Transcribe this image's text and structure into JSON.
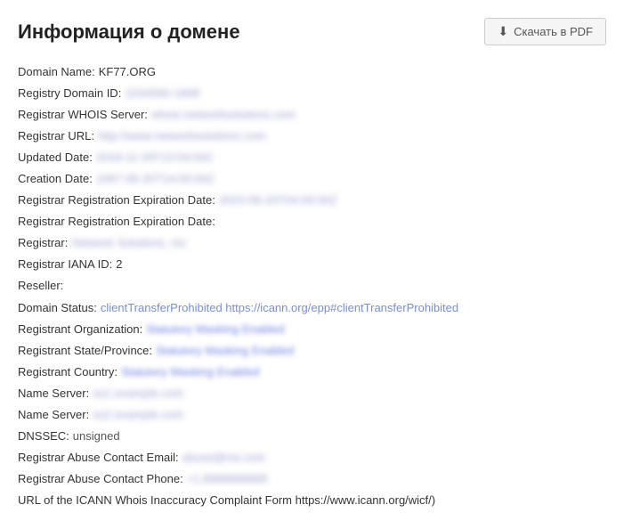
{
  "header": {
    "title": "Информация о домене",
    "pdf_button_label": "Скачать в PDF"
  },
  "whois": {
    "rows": [
      {
        "label": "Domain Name:",
        "value": "KF77.ORG",
        "type": "plain"
      },
      {
        "label": "Registry Domain ID:",
        "value": "1034560-1808",
        "type": "blur"
      },
      {
        "label": "Registrar WHOIS Server:",
        "value": "whois.networksolutions.com",
        "type": "blur"
      },
      {
        "label": "Registrar URL:",
        "value": "http://www.networksolutions.com",
        "type": "blur"
      },
      {
        "label": "Updated Date:",
        "value": "2018-11-29T13:54:002",
        "type": "blur"
      },
      {
        "label": "Creation Date:",
        "value": "1997-06-20T14:00:00Z",
        "type": "blur"
      },
      {
        "label": "Registrar Registration Expiration Date:",
        "value": "2023-06-20T04:00:00Z",
        "type": "blur"
      },
      {
        "label": "Registrar Registration Expiration Date:",
        "value": "",
        "type": "empty"
      },
      {
        "label": "Registrar:",
        "value": "Network Solutions, Inc",
        "type": "blur"
      },
      {
        "label": "Registrar IANA ID:",
        "value": "2",
        "type": "plain"
      },
      {
        "label": "Reseller:",
        "value": "",
        "type": "empty"
      },
      {
        "label": "Domain Status:",
        "value": "clientTransferProhibited https://icann.org/epp#clientTransferProhibited",
        "type": "status"
      },
      {
        "label": "Registrant Organization:",
        "value": "Statutory Masking Enabled",
        "type": "link"
      },
      {
        "label": "Registrant State/Province:",
        "value": "Statutory Masking Enabled",
        "type": "link"
      },
      {
        "label": "Registrant Country:",
        "value": "Statutory Masking Enabled",
        "type": "link"
      },
      {
        "label": "Name Server:",
        "value": "ns1.example.com",
        "type": "blur"
      },
      {
        "label": "Name Server:",
        "value": "ns2.example.com",
        "type": "blur"
      },
      {
        "label": "DNSSEC:",
        "value": "unsigned",
        "type": "normal"
      },
      {
        "label": "Registrar Abuse Contact Email:",
        "value": "abuse@nsi.com",
        "type": "blur"
      },
      {
        "label": "Registrar Abuse Contact Phone:",
        "value": "+1.8888888888",
        "type": "blur"
      },
      {
        "label": "URL of the ICANN Whois Inaccuracy Complaint Form https://www.icann.org/wicf/)",
        "value": "",
        "type": "long-label"
      }
    ]
  }
}
